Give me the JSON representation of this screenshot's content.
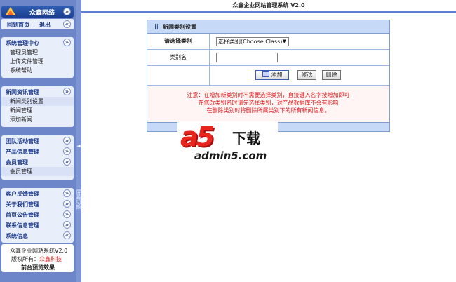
{
  "sidebar": {
    "brand_title": "众鑫网络",
    "links": {
      "home": "回到首页",
      "sep": "|",
      "logout": "退出"
    },
    "toggle_glyph": "«",
    "expand_glyph": "»",
    "groups": [
      {
        "title": "系统管理中心",
        "items": [
          "管理员管理",
          "上传文件管理",
          "系统帮助"
        ]
      },
      {
        "title": "新闻资讯管理",
        "items": [
          "新闻类别设置",
          "新闻管理",
          "添加新闻"
        ]
      },
      {
        "title": "团队活动管理",
        "items": []
      },
      {
        "title": "产品信息管理",
        "items": []
      },
      {
        "title": "会员管理",
        "items": [
          "会员管理"
        ]
      },
      {
        "title": "客户反馈管理",
        "items": []
      },
      {
        "title": "关于我们管理",
        "items": []
      },
      {
        "title": "首页公告管理",
        "items": []
      },
      {
        "title": "联系信息管理",
        "items": []
      },
      {
        "title": "系统信息",
        "items": []
      }
    ],
    "info": {
      "system": "众鑫企业网站系统V2.0",
      "copyright_label": "版权所有：",
      "company": "众鑫科技",
      "preview": "前台预览效果"
    }
  },
  "divider": {
    "arrow": "◄",
    "vertical_text": "屏幕切换"
  },
  "header": {
    "title": "众鑫企业网站管理系统 V2.0"
  },
  "form": {
    "bars": "||",
    "title": "新闻类别设置",
    "select_label": "请选择类别",
    "select_value": "选择类别(Choose Class)",
    "name_label": "类别名",
    "name_value": "",
    "buttons": {
      "add": "添加",
      "edit": "修改",
      "delete": "删除"
    },
    "notice": [
      "注意：在增加新类别时不需要选择类别，直接键入名字按增加即可",
      "在修改类别名时请先选择类别，对产品数据库不会有影响",
      "在删除类别时将删除所属类别下的所有新闻信息。"
    ]
  },
  "watermark": {
    "logo": "a5",
    "download": "下载",
    "domain": "admin5.com"
  },
  "colors": {
    "sidebar_bg": "#6c86c9",
    "panel_bg": "#e9eefb",
    "form_head": "#c6daf7",
    "notice_text": "#e02020"
  }
}
